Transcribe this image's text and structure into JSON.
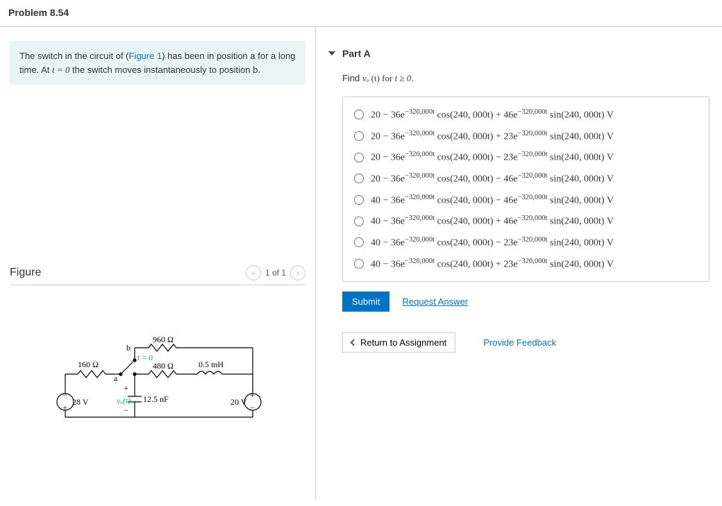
{
  "header": {
    "title": "Problem 8.54"
  },
  "info": {
    "text_prefix": "The switch in the circuit of (",
    "figure_link": "Figure 1",
    "text_mid": ") has been in position a for a long time. At ",
    "cond": "t = 0",
    "text_suffix": " the switch moves instantaneously to position b."
  },
  "figure": {
    "label": "Figure",
    "pager": "1 of 1",
    "labels": {
      "r160": "160 Ω",
      "r960": "960 Ω",
      "r480": "480 Ω",
      "L": "0.5 mH",
      "C": "12.5 nF",
      "vsL": "28 V",
      "vsR": "20 V",
      "t0": "t = 0",
      "a": "a",
      "b": "b",
      "vo": "vₒ(t)"
    }
  },
  "part": {
    "title": "Part A",
    "prompt_prefix": "Find ",
    "prompt_vo": "vₒ",
    "prompt_t": " (t) for ",
    "prompt_cond": "t ≥ 0",
    "prompt_suffix": "."
  },
  "options": [
    {
      "A": "20",
      "cs": "−",
      "B": "36",
      "sign": "+",
      "C": "46"
    },
    {
      "A": "20",
      "cs": "−",
      "B": "36",
      "sign": "+",
      "C": "23"
    },
    {
      "A": "20",
      "cs": "−",
      "B": "36",
      "sign": "−",
      "C": "23"
    },
    {
      "A": "20",
      "cs": "−",
      "B": "36",
      "sign": "−",
      "C": "46"
    },
    {
      "A": "40",
      "cs": "−",
      "B": "36",
      "sign": "−",
      "C": "46"
    },
    {
      "A": "40",
      "cs": "−",
      "B": "36",
      "sign": "+",
      "C": "46"
    },
    {
      "A": "40",
      "cs": "−",
      "B": "36",
      "sign": "−",
      "C": "23"
    },
    {
      "A": "40",
      "cs": "−",
      "B": "36",
      "sign": "+",
      "C": "23"
    }
  ],
  "expr": {
    "exp1": "−320,000t",
    "cos": " cos(240, 000t)",
    "exp2": "−320,000t",
    "sin": " sin(240, 000t) V"
  },
  "actions": {
    "submit": "Submit",
    "request": "Request Answer",
    "return": "Return to Assignment",
    "feedback": "Provide Feedback"
  }
}
